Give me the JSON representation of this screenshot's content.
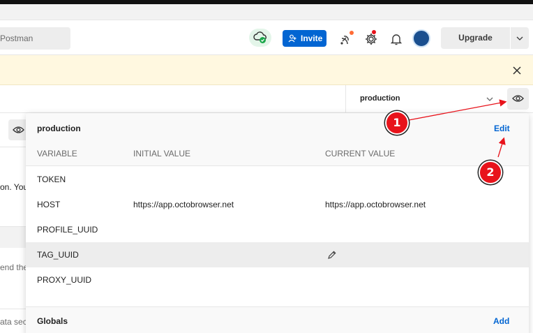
{
  "header": {
    "search_placeholder": "Postman",
    "invite_label": "Invite",
    "upgrade_label": "Upgrade"
  },
  "environment": {
    "selected": "production"
  },
  "background": {
    "snippet_1": "on. You",
    "snippet_2": "end the",
    "snippet_3": "ata sec"
  },
  "popover": {
    "title": "production",
    "edit_label": "Edit",
    "columns": [
      "VARIABLE",
      "INITIAL VALUE",
      "CURRENT VALUE"
    ],
    "rows": [
      {
        "variable": "TOKEN",
        "initial": "",
        "current": ""
      },
      {
        "variable": "HOST",
        "initial": "https://app.octobrowser.net",
        "current": "https://app.octobrowser.net"
      },
      {
        "variable": "PROFILE_UUID",
        "initial": "",
        "current": ""
      },
      {
        "variable": "TAG_UUID",
        "initial": "",
        "current": ""
      },
      {
        "variable": "PROXY_UUID",
        "initial": "",
        "current": ""
      }
    ],
    "globals_label": "Globals",
    "globals_add_label": "Add"
  },
  "annotations": {
    "marker_1": "1",
    "marker_2": "2",
    "color": "#e8131b"
  },
  "colors": {
    "accent": "#0265d2",
    "banner": "#fff8e0",
    "sync_ok": "#1aa64a"
  },
  "icons": [
    "cloud-check-icon",
    "add-user-icon",
    "satellite-icon",
    "gear-icon",
    "bell-icon",
    "close-icon",
    "chevron-down-icon",
    "eye-icon",
    "pencil-icon"
  ]
}
